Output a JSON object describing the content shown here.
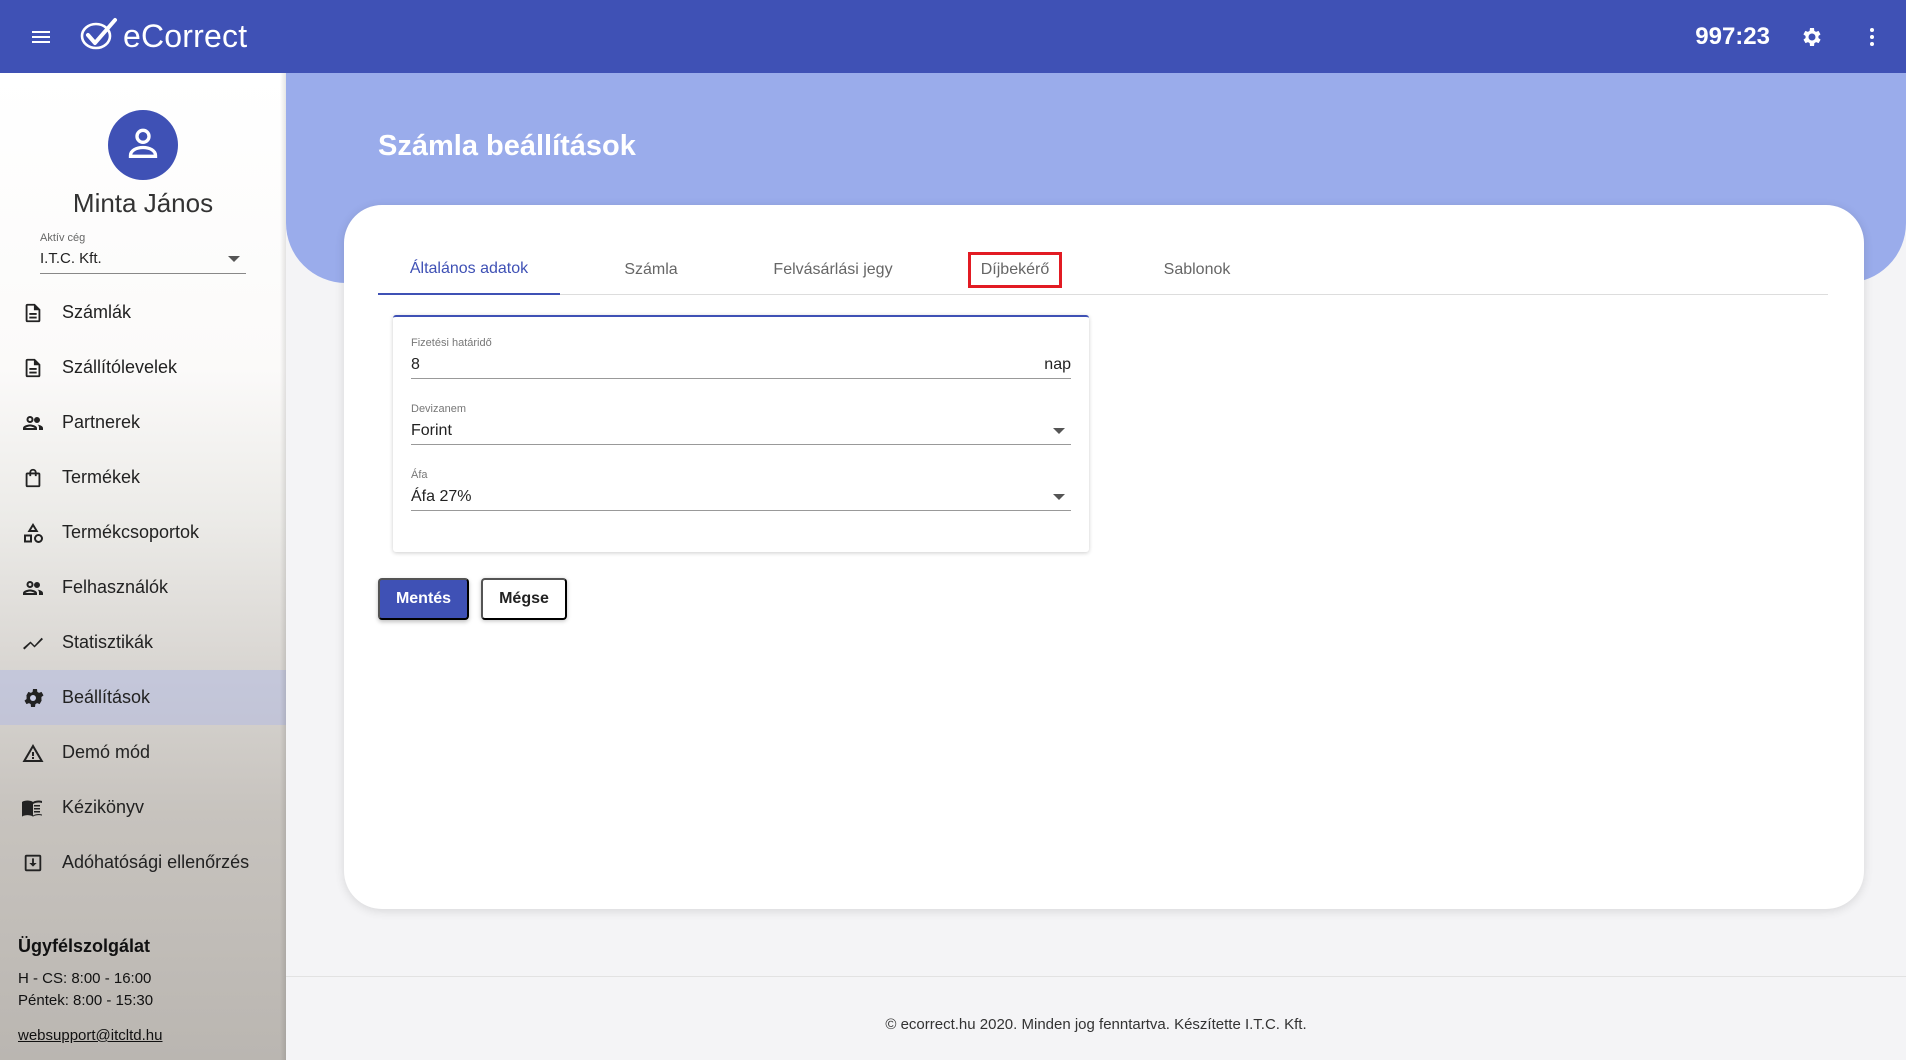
{
  "topbar": {
    "brand": "eCorrect",
    "timer": "997:23",
    "icons": {
      "menu": "menu-icon",
      "logo": "check-logo-icon",
      "settings": "gear-icon",
      "more": "more-vert-icon"
    }
  },
  "sidebar": {
    "user_name": "Minta János",
    "company_label": "Aktív cég",
    "company_value": "I.T.C. Kft.",
    "items": [
      {
        "label": "Számlák",
        "icon": "document-icon"
      },
      {
        "label": "Szállítólevelek",
        "icon": "document-icon"
      },
      {
        "label": "Partnerek",
        "icon": "people-icon"
      },
      {
        "label": "Termékek",
        "icon": "shopping-bag-icon"
      },
      {
        "label": "Termékcsoportok",
        "icon": "category-icon"
      },
      {
        "label": "Felhasználók",
        "icon": "people-icon"
      },
      {
        "label": "Statisztikák",
        "icon": "trending-icon"
      },
      {
        "label": "Beállítások",
        "icon": "gear-icon",
        "active": true
      },
      {
        "label": "Demó mód",
        "icon": "warning-icon"
      },
      {
        "label": "Kézikönyv",
        "icon": "book-icon"
      },
      {
        "label": "Adóhatósági ellenőrzés",
        "icon": "archive-download-icon"
      }
    ],
    "support": {
      "title": "Ügyfélszolgálat",
      "hours_1": "H - CS: 8:00 - 16:00",
      "hours_2": "Péntek: 8:00 - 15:30",
      "email": "websupport@itcltd.hu"
    }
  },
  "main": {
    "page_title": "Számla beállítások",
    "tabs": [
      {
        "label": "Általános adatok",
        "active": true
      },
      {
        "label": "Számla"
      },
      {
        "label": "Felvásárlási jegy"
      },
      {
        "label": "Díjbekérő",
        "highlighted": true
      },
      {
        "label": "Sablonok"
      }
    ],
    "form": {
      "payment_deadline": {
        "label": "Fizetési határidő",
        "value": "8",
        "suffix": "nap"
      },
      "currency": {
        "label": "Devizanem",
        "value": "Forint"
      },
      "vat": {
        "label": "Áfa",
        "value": "Áfa 27%"
      }
    },
    "buttons": {
      "save": "Mentés",
      "cancel": "Mégse"
    }
  },
  "footer": {
    "text": "© ecorrect.hu 2020. Minden jog fenntartva. Készítette I.T.C. Kft."
  },
  "colors": {
    "primary": "#3f51b5",
    "hero": "#9aaceb",
    "highlight": "#e21b23"
  }
}
